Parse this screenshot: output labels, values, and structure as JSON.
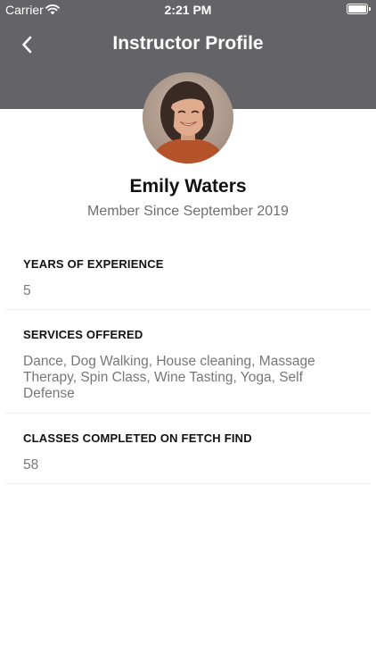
{
  "status_bar": {
    "carrier": "Carrier",
    "time": "2:21 PM",
    "icons": [
      "wifi-icon",
      "battery-icon"
    ]
  },
  "nav": {
    "title": "Instructor Profile",
    "back_icon": "chevron-left-icon"
  },
  "colors": {
    "header_bg": "#646468",
    "text_primary": "#111111",
    "text_secondary": "#777777"
  },
  "profile": {
    "name": "Emily Waters",
    "member_since": "Member Since September 2019"
  },
  "sections": [
    {
      "label": "YEARS OF EXPERIENCE",
      "value": "5"
    },
    {
      "label": "SERVICES OFFERED",
      "value": "Dance, Dog Walking, House cleaning, Massage Therapy, Spin Class, Wine Tasting, Yoga, Self Defense"
    },
    {
      "label": "CLASSES COMPLETED ON FETCH FIND",
      "value": "58"
    }
  ]
}
